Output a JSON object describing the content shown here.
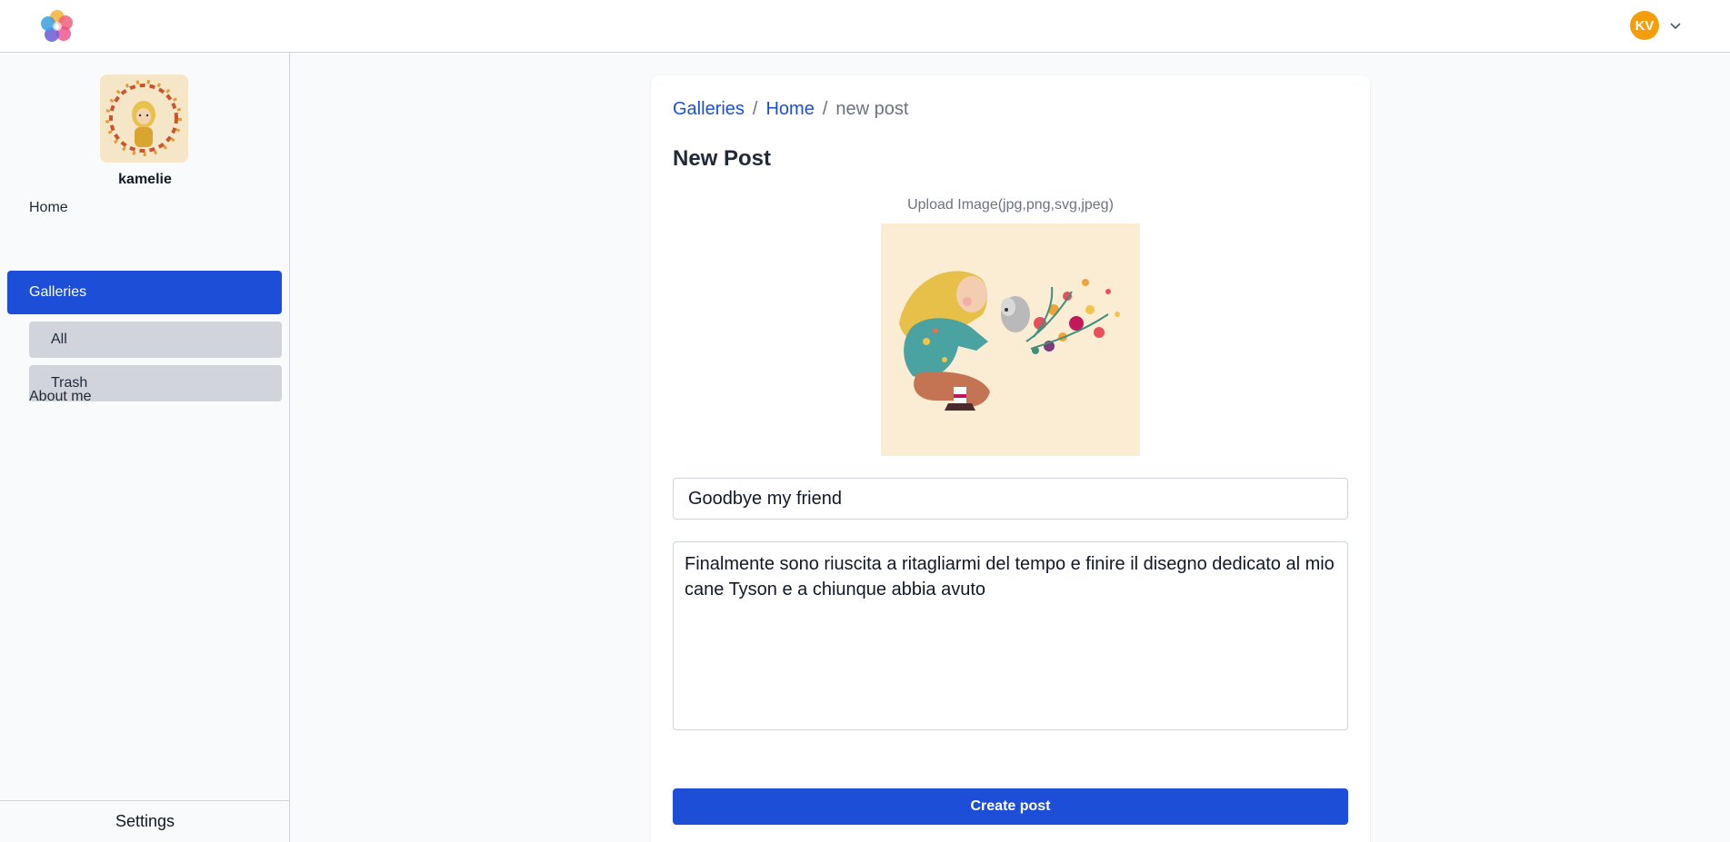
{
  "app": {
    "logo_icon": "pinwheel-logo-icon"
  },
  "user": {
    "initials": "KV",
    "avatar_color": "#f59e0b",
    "menu_icon": "chevron-down-icon"
  },
  "sidebar": {
    "profile_name": "kamelie",
    "items": [
      {
        "label": "Home",
        "active": false
      },
      {
        "label": "Galleries",
        "active": true
      },
      {
        "label": "About me",
        "active": false
      }
    ],
    "sub_items": [
      {
        "label": "All"
      },
      {
        "label": "Trash"
      }
    ],
    "settings_label": "Settings"
  },
  "breadcrumb": [
    {
      "label": "Galleries"
    },
    {
      "label": "Home"
    },
    {
      "label": "new post"
    }
  ],
  "form": {
    "heading": "New Post",
    "upload_label": "Upload Image(jpg,png,svg,jpeg)",
    "title_value": "Goodbye my friend",
    "description_value": "Finalmente sono riuscita a ritagliarmi del tempo e finire il disegno dedicato al mio cane Tyson e a chiunque abbia avuto",
    "submit_label": "Create post"
  },
  "colors": {
    "accent": "#1d4ed8",
    "submenu_bg": "#d1d5db"
  }
}
